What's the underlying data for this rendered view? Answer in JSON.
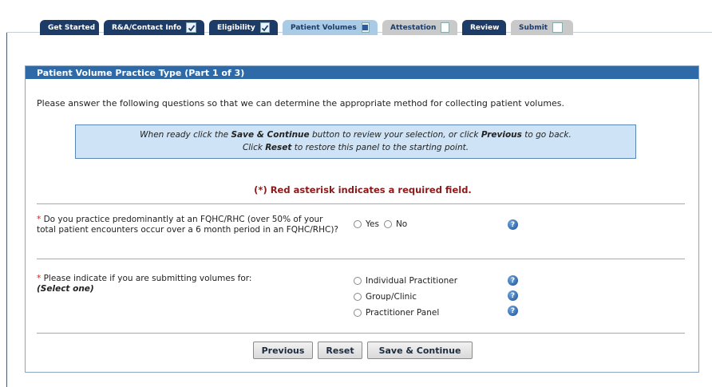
{
  "tabs": [
    {
      "label": "Get Started",
      "state": "none"
    },
    {
      "label": "R&A/Contact Info",
      "state": "checked"
    },
    {
      "label": "Eligibility",
      "state": "checked"
    },
    {
      "label": "Patient Volumes",
      "state": "in-progress"
    },
    {
      "label": "Attestation",
      "state": "empty"
    },
    {
      "label": "Review",
      "state": "none"
    },
    {
      "label": "Submit",
      "state": "empty"
    }
  ],
  "panel": {
    "title": "Patient Volume Practice Type (Part 1 of 3)",
    "intro": "Please answer the following questions so that we can determine the appropriate method for collecting patient volumes.",
    "info": {
      "line1_pre": "When ready click the ",
      "line1_save": "Save & Continue",
      "line1_mid": " button to review your selection, or click ",
      "line1_prev": "Previous",
      "line1_post": " to go back.",
      "line2_pre": "Click ",
      "line2_reset": "Reset",
      "line2_post": " to restore this panel to the starting point."
    },
    "required_note": "(*) Red asterisk indicates a required field.",
    "q1": {
      "asterisk": "*",
      "text": " Do you practice predominantly at an FQHC/RHC (over 50% of your total patient encounters occur over a 6 month period in an FQHC/RHC)?",
      "options": [
        "Yes",
        "No"
      ]
    },
    "q2": {
      "asterisk": "*",
      "text": " Please indicate if you are submitting volumes for:",
      "subtext": "(Select one)",
      "options": [
        "Individual Practitioner",
        "Group/Clinic",
        "Practitioner Panel"
      ]
    },
    "buttons": {
      "previous": "Previous",
      "reset": "Reset",
      "save": "Save & Continue"
    },
    "help_glyph": "?"
  },
  "colors": {
    "tab_dark": "#1c3b66",
    "tab_active": "#a9cbe5",
    "tab_gray": "#c9c9c9",
    "header": "#2e6aa8",
    "info_bg": "#cfe3f6",
    "required": "#8b1a1a"
  }
}
